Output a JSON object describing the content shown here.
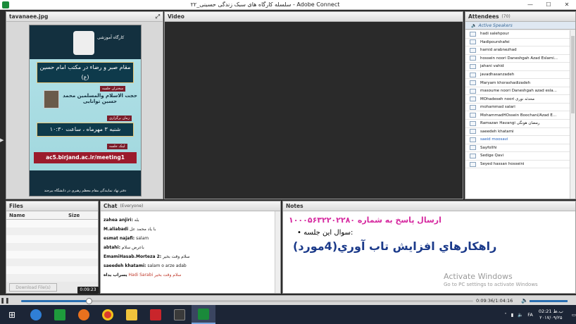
{
  "window": {
    "title": "سلسله کارگاه های سبک زندگی حسینی_۲۲ - Adobe Connect",
    "minimize": "—",
    "maximize": "☐",
    "close": "✕"
  },
  "share_pod": {
    "title": "tavanaee.jpg",
    "poster": {
      "header": "کارگاه آموزشی",
      "band1": "مقام صبر و رضاء در مکتب امام حسین (ع)",
      "speaker_tag": "سخنران جلسه",
      "speaker": "حجت الاسلام والمسلمین محمد حسین توانایی",
      "time_tag": "زمان برگزاری",
      "time": "شنبه ۳ مهرماه ، ساعت ۱۰:۳۰",
      "link_tag": "لینک جلسه",
      "link": "ac5.birjand.ac.ir/meeting1",
      "footer": "دفتر نهاد نمایندگی مقام معظم رهبری در دانشگاه بیرجند"
    }
  },
  "video_pod": {
    "title": "Video"
  },
  "attendees_pod": {
    "title": "Attendees",
    "count": "(70)",
    "section": "Active Speakers",
    "list": [
      "hadi salehpour",
      "Hadipourshafei",
      "hamid arabnezhad",
      "hossein noori Daneshgah Azad Eslami...",
      "jahani vahid",
      "javadhasanzadeh",
      "Maryam khorashadizadeh",
      "masoume noori Daneshgah azad esla...",
      "MOhadeseh noori محدثه نوری",
      "mohammad salari",
      "MohammadHOssein Boochani/Azad E...",
      "Ramazan Havangi رمضان هونگی",
      "saeedeh khatami",
      "saeid moosavi",
      "Sayfollhi",
      "Sedige Qavi",
      "Seyed hassan hosseini"
    ]
  },
  "files_pod": {
    "title": "Files",
    "col_name": "Name",
    "col_size": "Size",
    "download_button": "Download File(s)"
  },
  "chat_pod": {
    "title": "Chat",
    "scope": "(Everyone)",
    "messages": [
      {
        "sender": "zahea anjiri:",
        "text": "بله"
      },
      {
        "sender": "M.aliabadi",
        "text": "با یاد محمد عل"
      },
      {
        "sender": "esmat najafi:",
        "text": "salam"
      },
      {
        "sender": "abtahi:",
        "text": "باعرض سلام"
      },
      {
        "sender": "EmamiHasab.Morteza 2:",
        "text": "سلام وقت بخیر"
      },
      {
        "sender": "saeedeh khatami:",
        "text": "salam o arze adab"
      },
      {
        "sender": "یسراب یداه",
        "text": "Hadi Sarabi سلام وقت بخیر"
      }
    ]
  },
  "notes_pod": {
    "title": "Notes",
    "line1": "ارسال پاسخ به شماره ۱۰۰۰۵۶۳۲۲۰۲۲۸۰",
    "line2": "سوال این جلسه:",
    "line3": "راهکارهاي افزايش تاب آوري(4مورد)",
    "watermark_title": "Activate Windows",
    "watermark_sub": "Go to PC settings to activate Windows"
  },
  "playback": {
    "tooltip": "0:09:23",
    "time": "0:09:36/1:04:16",
    "progress": 0.149
  },
  "taskbar": {
    "clock_time": "02:21 ب.ظ",
    "clock_date": "۲۰۱۷/۰۹/۲۵",
    "lang": "FA"
  }
}
